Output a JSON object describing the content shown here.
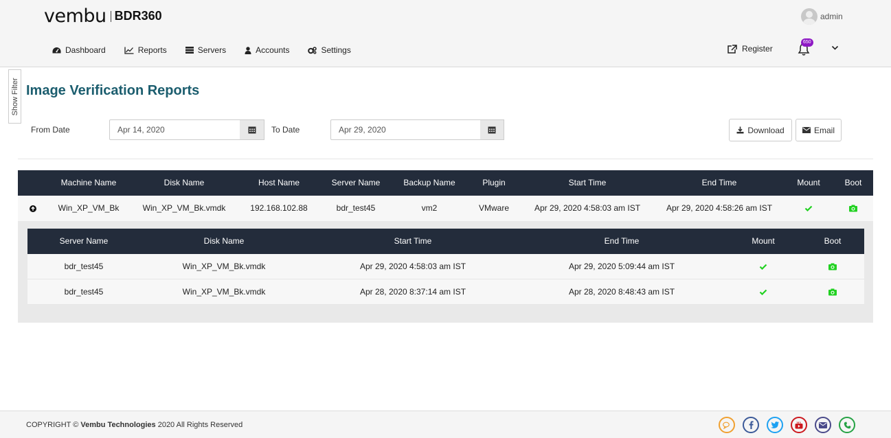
{
  "brand": {
    "name": "vembu",
    "product": "BDR360"
  },
  "user": {
    "name": "admin"
  },
  "nav": [
    {
      "label": "Dashboard",
      "icon": "dashboard-icon"
    },
    {
      "label": "Reports",
      "icon": "line-chart-icon"
    },
    {
      "label": "Servers",
      "icon": "server-icon"
    },
    {
      "label": "Accounts",
      "icon": "user-icon"
    },
    {
      "label": "Settings",
      "icon": "gears-icon"
    }
  ],
  "header_right": {
    "register_label": "Register",
    "notification_count": "650"
  },
  "filter_tab": {
    "label": "Show Filter"
  },
  "page": {
    "title": "Image Verification Reports"
  },
  "filters": {
    "from_label": "From Date",
    "from_value": "Apr 14, 2020",
    "to_label": "To Date",
    "to_value": "Apr 29, 2020"
  },
  "actions": {
    "download_label": "Download",
    "email_label": "Email"
  },
  "main_table": {
    "columns": [
      "Machine Name",
      "Disk Name",
      "Host Name",
      "Server Name",
      "Backup Name",
      "Plugin",
      "Start Time",
      "End Time",
      "Mount",
      "Boot"
    ],
    "row": {
      "machine_name": "Win_XP_VM_Bk",
      "disk_name": "Win_XP_VM_Bk.vmdk",
      "host_name": "192.168.102.88",
      "server_name": "bdr_test45",
      "backup_name": "vm2",
      "plugin": "VMware",
      "start_time": "Apr 29, 2020 4:58:03 am IST",
      "end_time": "Apr 29, 2020 4:58:26 am IST"
    }
  },
  "sub_table": {
    "columns": [
      "Server Name",
      "Disk Name",
      "Start Time",
      "End Time",
      "Mount",
      "Boot"
    ],
    "rows": [
      {
        "server_name": "bdr_test45",
        "disk_name": "Win_XP_VM_Bk.vmdk",
        "start_time": "Apr 29, 2020 4:58:03 am IST",
        "end_time": "Apr 29, 2020 5:09:44 am IST"
      },
      {
        "server_name": "bdr_test45",
        "disk_name": "Win_XP_VM_Bk.vmdk",
        "start_time": "Apr 28, 2020 8:37:14 am IST",
        "end_time": "Apr 28, 2020 8:48:43 am IST"
      }
    ]
  },
  "footer": {
    "copyright_prefix": "COPYRIGHT ©",
    "company": "Vembu Technologies",
    "copyright_suffix": "2020 All Rights Reserved",
    "socials": [
      {
        "icon": "chat-icon",
        "color": "#f0a030"
      },
      {
        "icon": "facebook-icon",
        "color": "#3b5998"
      },
      {
        "icon": "twitter-icon",
        "color": "#1da1f2"
      },
      {
        "icon": "youtube-icon",
        "color": "#cc181e"
      },
      {
        "icon": "email-icon",
        "color": "#4a4a8a"
      },
      {
        "icon": "whatsapp-icon",
        "color": "#25a244"
      }
    ]
  },
  "colors": {
    "title": "#1b5d6e",
    "table_header": "#232c3b",
    "status_green": "#21d121",
    "badge": "#8e19c4"
  }
}
